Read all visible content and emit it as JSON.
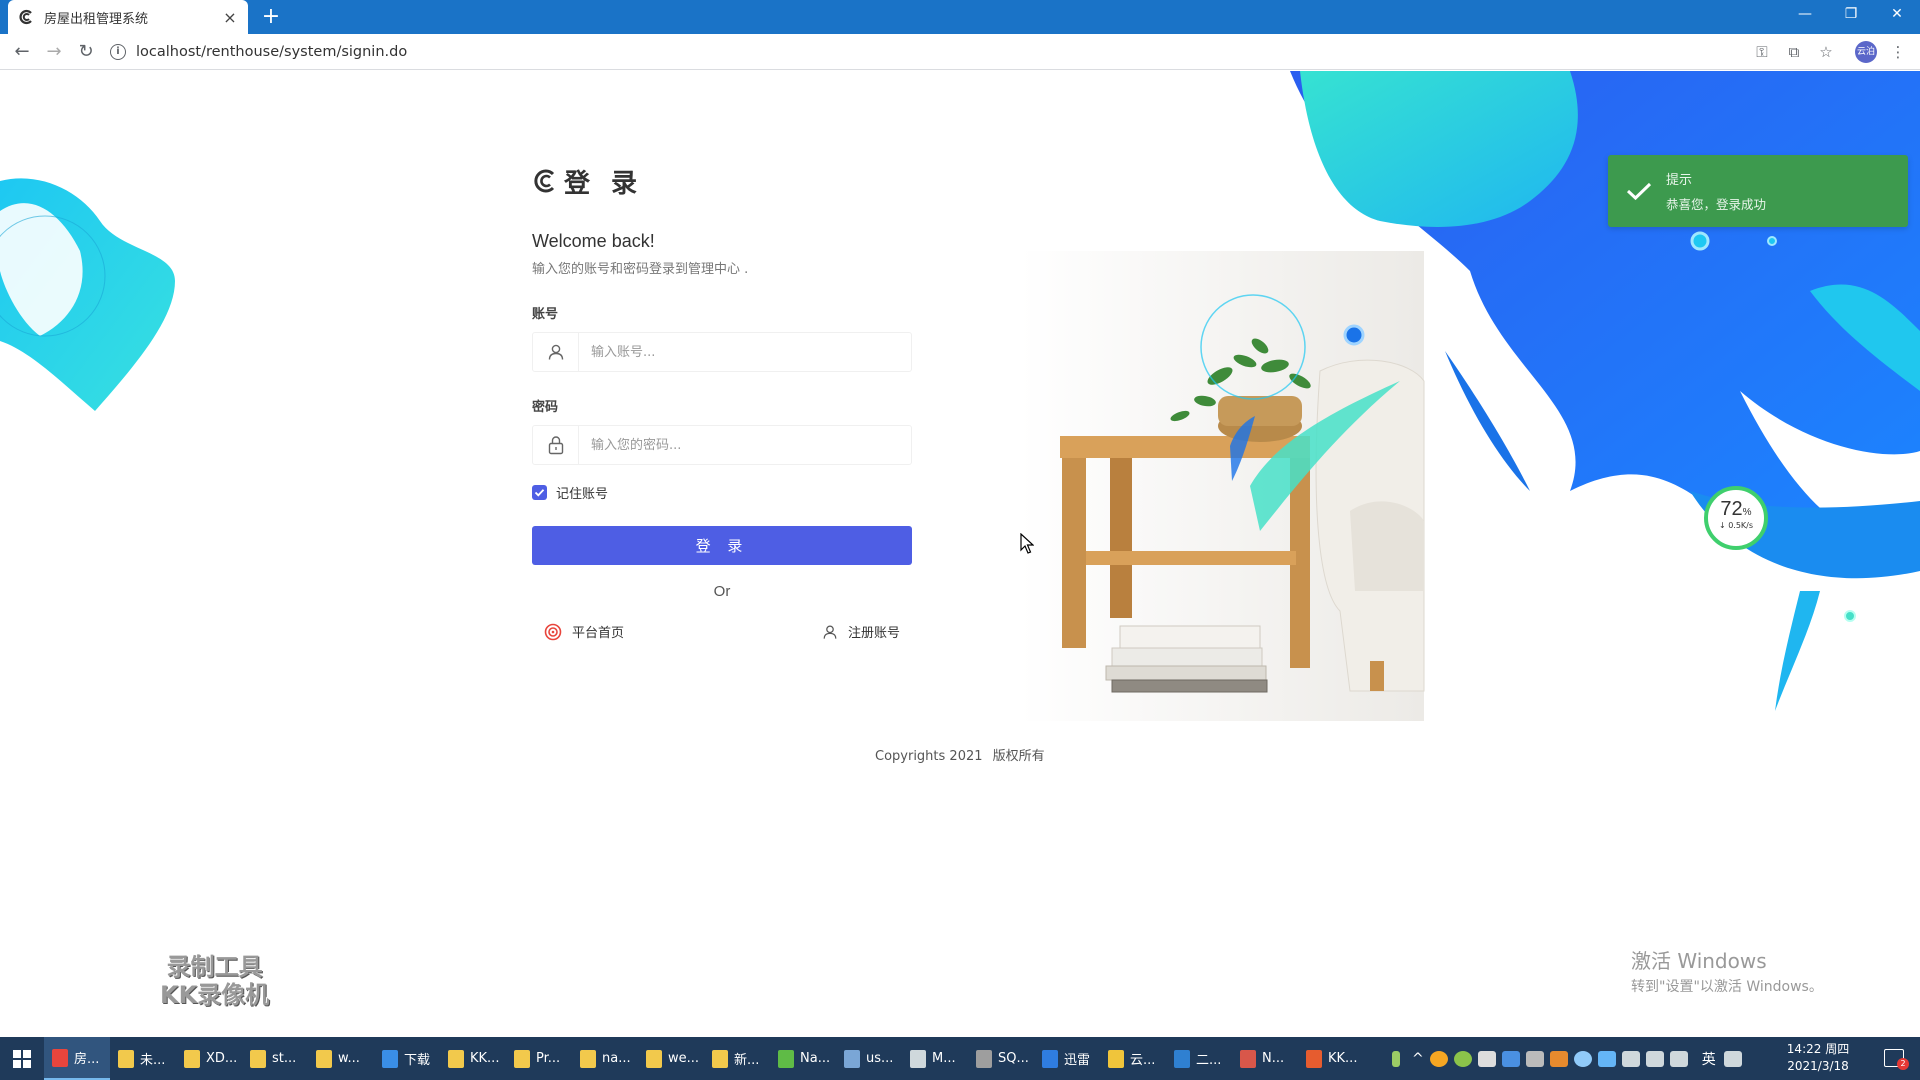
{
  "browser": {
    "tab_title": "房屋出租管理系统",
    "tab_close": "×",
    "new_tab": "+",
    "url": "localhost/renthouse/system/signin.do",
    "profile_label": "云泊",
    "window_controls": [
      "—",
      "❐",
      "✕"
    ]
  },
  "login": {
    "title": "登 录",
    "welcome": "Welcome back!",
    "subtitle": "输入您的账号和密码登录到管理中心 .",
    "account_label": "账号",
    "account_placeholder": "输入账号...",
    "password_label": "密码",
    "password_placeholder": "输入您的密码...",
    "remember_label": "记住账号",
    "remember_checked": true,
    "submit_label": "登 录",
    "or_text": "Or",
    "home_link": "平台首页",
    "register_link": "注册账号"
  },
  "footer": {
    "copyright": "Copyrights 2021",
    "rights": "版权所有"
  },
  "toast": {
    "title": "提示",
    "message": "恭喜您，登录成功",
    "color": "#3d9a4e"
  },
  "speed_widget": {
    "percent": "72",
    "unit": "%",
    "rate": "↓ 0.5K/s"
  },
  "overlay": {
    "watermark_line1": "录制工具",
    "watermark_line2": "KK录像机",
    "activate_line1": "激活 Windows",
    "activate_line2": "转到\"设置\"以激活 Windows。"
  },
  "taskbar": {
    "items": [
      {
        "label": "房...",
        "icon": "chrome-icon",
        "color": "#e8453c",
        "active": true
      },
      {
        "label": "未...",
        "icon": "folder-icon",
        "color": "#f2c94c"
      },
      {
        "label": "XD...",
        "icon": "folder-icon",
        "color": "#f2c94c"
      },
      {
        "label": "st...",
        "icon": "folder-icon",
        "color": "#f2c94c"
      },
      {
        "label": "w...",
        "icon": "folder-icon",
        "color": "#f2c94c"
      },
      {
        "label": "下载",
        "icon": "download-icon",
        "color": "#3a8ee6"
      },
      {
        "label": "KK...",
        "icon": "folder-icon",
        "color": "#f2c94c"
      },
      {
        "label": "Pr...",
        "icon": "folder-icon",
        "color": "#f2c94c"
      },
      {
        "label": "na...",
        "icon": "folder-icon",
        "color": "#f2c94c"
      },
      {
        "label": "we...",
        "icon": "folder-icon",
        "color": "#f2c94c"
      },
      {
        "label": "新...",
        "icon": "folder-icon",
        "color": "#f2c94c"
      },
      {
        "label": "Na...",
        "icon": "navicat-icon",
        "color": "#5fbb46"
      },
      {
        "label": "us...",
        "icon": "table-icon",
        "color": "#7aa6d6"
      },
      {
        "label": "M...",
        "icon": "pen-icon",
        "color": "#cfd8dc"
      },
      {
        "label": "SQ...",
        "icon": "tools-icon",
        "color": "#9e9e9e"
      },
      {
        "label": "迅雷",
        "icon": "thunder-icon",
        "color": "#2f7de1"
      },
      {
        "label": "云...",
        "icon": "python-icon",
        "color": "#f0c53b"
      },
      {
        "label": "二...",
        "icon": "vscode-icon",
        "color": "#2f80d1"
      },
      {
        "label": "N...",
        "icon": "app-icon",
        "color": "#d8574a"
      },
      {
        "label": "KK...",
        "icon": "recorder-icon",
        "color": "#e65c2f"
      }
    ],
    "ime": "英",
    "time": "14:22 周四",
    "date": "2021/3/18",
    "notification_count": "2"
  }
}
